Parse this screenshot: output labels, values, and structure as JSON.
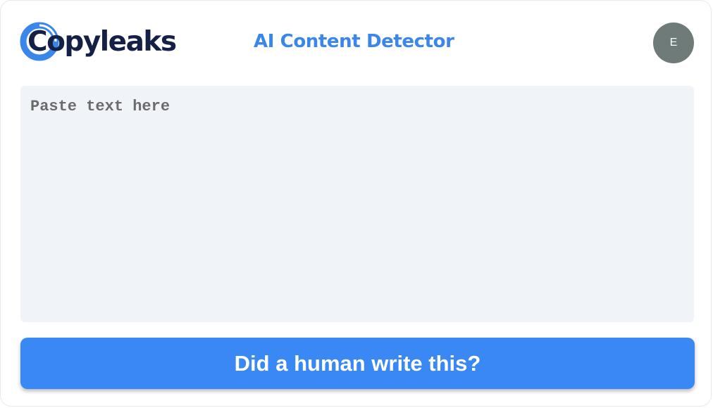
{
  "header": {
    "logo_text": "Copyleaks",
    "title": "AI Content Detector",
    "avatar_initial": "E"
  },
  "input": {
    "placeholder": "Paste text here",
    "value": ""
  },
  "submit": {
    "label": "Did a human write this?"
  },
  "colors": {
    "brand_blue": "#3a86ea",
    "brand_navy": "#152046",
    "button_bg": "#3a88f4",
    "textarea_bg": "#f0f4f8",
    "avatar_bg": "#6f7b78"
  },
  "icons": {
    "logo": "copyleaks-ring-logo-icon"
  }
}
